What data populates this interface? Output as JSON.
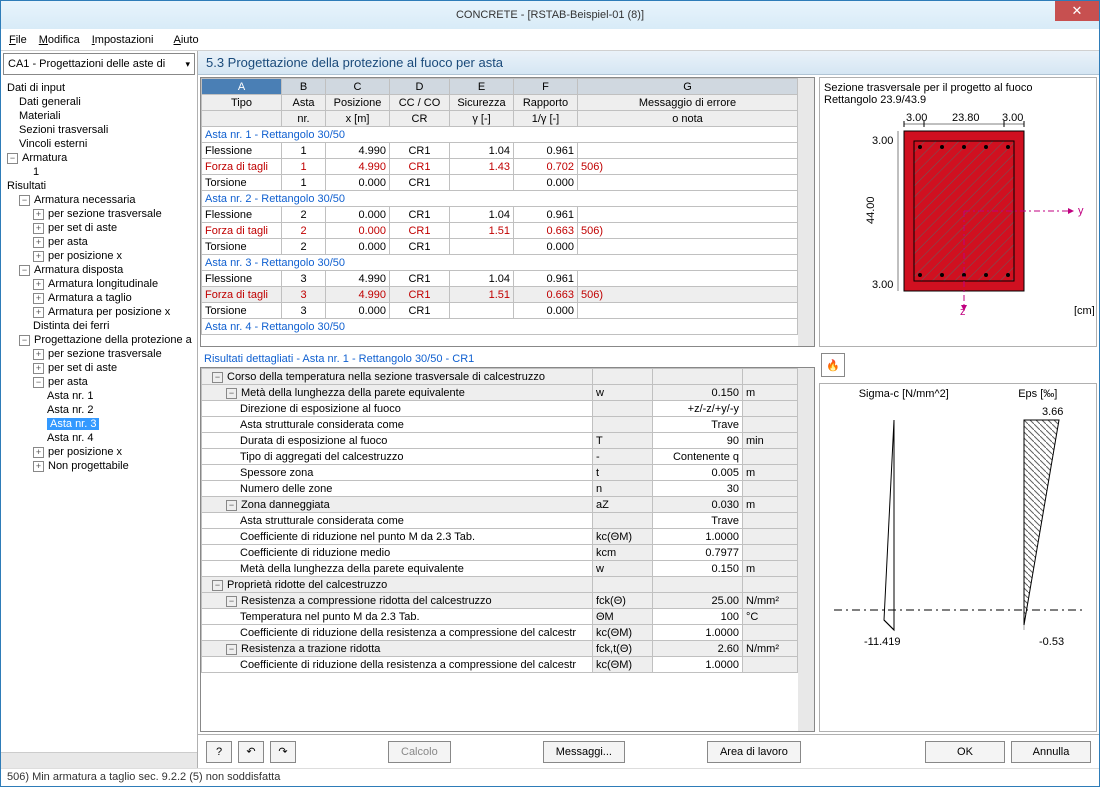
{
  "window": {
    "title": "CONCRETE - [RSTAB-Beispiel-01 (8)]"
  },
  "menu": {
    "file": "File",
    "edit": "Modifica",
    "settings": "Impostazioni",
    "help": "Aiuto"
  },
  "combo": {
    "value": "CA1 - Progettazioni delle aste di"
  },
  "tree": {
    "n0": "Dati di input",
    "n1": "Dati generali",
    "n2": "Materiali",
    "n3": "Sezioni trasversali",
    "n4": "Vincoli esterni",
    "n5": "Armatura",
    "n6": "1",
    "n7": "Risultati",
    "n8": "Armatura necessaria",
    "n9": "per sezione trasversale",
    "n10": "per set di aste",
    "n11": "per asta",
    "n12": "per posizione x",
    "n13": "Armatura disposta",
    "n14": "Armatura longitudinale",
    "n15": "Armatura a taglio",
    "n16": "Armatura per posizione x",
    "n17": "Distinta dei ferri",
    "n18": "Progettazione della protezione a",
    "n19": "per sezione trasversale",
    "n20": "per set di aste",
    "n21": "per asta",
    "n22": "Asta nr. 1",
    "n23": "Asta nr. 2",
    "n24": "Asta nr. 3",
    "n25": "Asta nr. 4",
    "n26": "per posizione x",
    "n27": "Non progettabile"
  },
  "section_title": "5.3 Progettazione della protezione al fuoco per asta",
  "cols": {
    "a": "A",
    "b": "B",
    "c": "C",
    "d": "D",
    "e": "E",
    "f": "F",
    "g": "G",
    "tipo": "Tipo",
    "asta": "Asta",
    "asta2": "nr.",
    "pos": "Posizione",
    "pos2": "x [m]",
    "cc": "CC / CO",
    "cc2": "CR",
    "sic": "Sicurezza",
    "sic2": "γ [-]",
    "rap": "Rapporto",
    "rap2": "1/γ [-]",
    "msg": "Messaggio di errore",
    "msg2": "o nota"
  },
  "groups": {
    "g1": "Asta nr. 1 - Rettangolo 30/50",
    "g2": "Asta nr. 2 - Rettangolo 30/50",
    "g3": "Asta nr. 3 - Rettangolo 30/50",
    "g4": "Asta nr. 4 - Rettangolo 30/50"
  },
  "rows": [
    {
      "tipo": "Flessione",
      "asta": "1",
      "pos": "4.990",
      "cc": "CR1",
      "sic": "1.04",
      "rap": "0.961",
      "msg": ""
    },
    {
      "tipo": "Forza di tagli",
      "asta": "1",
      "pos": "4.990",
      "cc": "CR1",
      "sic": "1.43",
      "rap": "0.702",
      "msg": "506)",
      "red": true
    },
    {
      "tipo": "Torsione",
      "asta": "1",
      "pos": "0.000",
      "cc": "CR1",
      "sic": "",
      "rap": "0.000",
      "msg": ""
    },
    {
      "tipo": "Flessione",
      "asta": "2",
      "pos": "0.000",
      "cc": "CR1",
      "sic": "1.04",
      "rap": "0.961",
      "msg": ""
    },
    {
      "tipo": "Forza di tagli",
      "asta": "2",
      "pos": "0.000",
      "cc": "CR1",
      "sic": "1.51",
      "rap": "0.663",
      "msg": "506)",
      "red": true
    },
    {
      "tipo": "Torsione",
      "asta": "2",
      "pos": "0.000",
      "cc": "CR1",
      "sic": "",
      "rap": "0.000",
      "msg": ""
    },
    {
      "tipo": "Flessione",
      "asta": "3",
      "pos": "4.990",
      "cc": "CR1",
      "sic": "1.04",
      "rap": "0.961",
      "msg": ""
    },
    {
      "tipo": "Forza di tagli",
      "asta": "3",
      "pos": "4.990",
      "cc": "CR1",
      "sic": "1.51",
      "rap": "0.663",
      "msg": "506)",
      "red": true,
      "hl": true
    },
    {
      "tipo": "Torsione",
      "asta": "3",
      "pos": "0.000",
      "cc": "CR1",
      "sic": "",
      "rap": "0.000",
      "msg": ""
    }
  ],
  "details_title": "Risultati dettagliati - Asta nr. 1  -  Rettangolo 30/50  -  CR1",
  "details": [
    {
      "lbl": "Corso della temperatura nella sezione trasversale di calcestruzzo",
      "hdr": 1,
      "ind": 0
    },
    {
      "lbl": "Metà della lunghezza della parete equivalente",
      "sym": "w",
      "val": "0.150",
      "unit": "m",
      "hdr": 1,
      "ind": 1
    },
    {
      "lbl": "Direzione di esposizione al fuoco",
      "sym": "",
      "val": "+z/-z/+y/-y",
      "unit": "",
      "ind": 2
    },
    {
      "lbl": "Asta strutturale considerata come",
      "sym": "",
      "val": "Trave",
      "unit": "",
      "ind": 2
    },
    {
      "lbl": "Durata di esposizione al fuoco",
      "sym": "T",
      "val": "90",
      "unit": "min",
      "ind": 2
    },
    {
      "lbl": "Tipo di aggregati del calcestruzzo",
      "sym": "-",
      "val": "Contenente q",
      "unit": "",
      "ind": 2
    },
    {
      "lbl": "Spessore zona",
      "sym": "t",
      "val": "0.005",
      "unit": "m",
      "ind": 2
    },
    {
      "lbl": "Numero delle zone",
      "sym": "n",
      "val": "30",
      "unit": "",
      "ind": 2
    },
    {
      "lbl": "Zona danneggiata",
      "sym": "aZ",
      "val": "0.030",
      "unit": "m",
      "hdr": 1,
      "ind": 1
    },
    {
      "lbl": "Asta strutturale considerata come",
      "sym": "",
      "val": "Trave",
      "unit": "",
      "ind": 2
    },
    {
      "lbl": "Coefficiente di riduzione nel punto M da 2.3 Tab.",
      "sym": "kc(ΘM)",
      "val": "1.0000",
      "unit": "",
      "ind": 2
    },
    {
      "lbl": "Coefficiente di riduzione medio",
      "sym": "kcm",
      "val": "0.7977",
      "unit": "",
      "ind": 2
    },
    {
      "lbl": "Metà della lunghezza della parete equivalente",
      "sym": "w",
      "val": "0.150",
      "unit": "m",
      "ind": 2
    },
    {
      "lbl": "Proprietà ridotte del calcestruzzo",
      "hdr": 1,
      "ind": 0
    },
    {
      "lbl": "Resistenza a compressione ridotta del calcestruzzo",
      "sym": "fck(Θ)",
      "val": "25.00",
      "unit": "N/mm²",
      "hdr": 1,
      "ind": 1
    },
    {
      "lbl": "Temperatura nel punto M da 2.3 Tab.",
      "sym": "ΘM",
      "val": "100",
      "unit": "°C",
      "ind": 2
    },
    {
      "lbl": "Coefficiente di riduzione della resistenza a compressione del calcestr",
      "sym": "kc(ΘM)",
      "val": "1.0000",
      "unit": "",
      "ind": 2
    },
    {
      "lbl": "Resistenza a trazione ridotta",
      "sym": "fck,t(Θ)",
      "val": "2.60",
      "unit": "N/mm²",
      "hdr": 1,
      "ind": 1
    },
    {
      "lbl": "Coefficiente di riduzione della resistenza a compressione del calcestr",
      "sym": "kc(ΘM)",
      "val": "1.0000",
      "unit": "",
      "ind": 2
    }
  ],
  "diagram_top": {
    "title1": "Sezione trasversale per il progetto al fuoco",
    "title2": "Rettangolo 23.9/43.9",
    "dim1": "3.00",
    "dim2": "23.80",
    "dim3": "3.00",
    "dim4": "44.00",
    "unit": "[cm]",
    "axis_y": "y",
    "axis_z": "z"
  },
  "diagram_bot": {
    "left_title": "Sigma-c [N/mm^2]",
    "right_title": "Eps [‰]",
    "val1": "-11.419",
    "val2": "3.66",
    "val3": "-0.53"
  },
  "buttons": {
    "calcolo": "Calcolo",
    "messaggi": "Messaggi...",
    "area": "Area di lavoro",
    "ok": "OK",
    "annulla": "Annulla"
  },
  "status": "506) Min armatura a taglio sec. 9.2.2 (5) non soddisfatta"
}
